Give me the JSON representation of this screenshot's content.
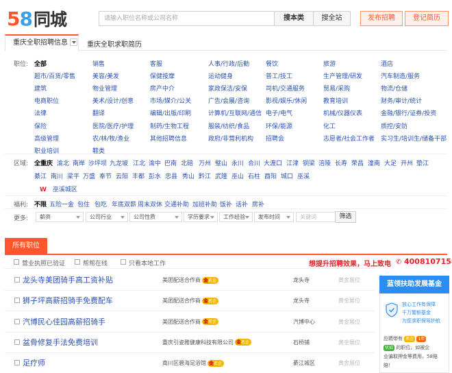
{
  "header": {
    "logo_num_a": "5",
    "logo_num_b": "8",
    "logo_cn": "同城",
    "search_placeholder": "请输入职位名称或公司名称",
    "search_button": "搜本类",
    "search_all_button": "搜全站",
    "post_button": "发布招聘",
    "resume_button": "登记简历"
  },
  "tabs": {
    "tab1": "重庆全职招聘信息",
    "tab2": "重庆全职求职简历"
  },
  "jobs": {
    "label": "职位:",
    "items": [
      "全部",
      "销售",
      "客服",
      "人事/行政/后勤",
      "餐饮",
      "旅游",
      "酒店",
      "超市/百货/零售",
      "美容/美发",
      "保健按摩",
      "运动健身",
      "普工/技工",
      "生产管理/研发",
      "汽车制造/服务",
      "建筑",
      "物业管理",
      "房产中介",
      "家政保洁/安保",
      "司机/交通服务",
      "贸易/采购",
      "物流/仓储",
      "电商职位",
      "美术/设计/创意",
      "市场/媒介/公关",
      "广告/会展/咨询",
      "影视/娱乐/休闲",
      "教育培训",
      "财务/审计/统计",
      "法律",
      "翻译",
      "编辑/出版/印刷",
      "计算机/互联网/通信",
      "电子/电气",
      "机械/仪器仪表",
      "金融/银行/证券/投资",
      "保险",
      "医院/医疗/护理",
      "制药/生物工程",
      "服装/纺织/食品",
      "环保/能源",
      "化工",
      "质控/安防",
      "高级管理",
      "农/林/牧/渔业",
      "其他招聘信息",
      "政府/非营利机构",
      "招聘会",
      "志愿者/社会工作者",
      "实习生/培训生/储备干部",
      "职业培训",
      "鞋类"
    ]
  },
  "areas": {
    "label": "区域:",
    "row1": [
      "全重庆",
      "渝北",
      "南岸",
      "沙坪坝",
      "九龙坡",
      "江北",
      "渝中",
      "巴南",
      "北碚",
      "万州",
      "璧山",
      "永川",
      "合川",
      "大渡口",
      "江津",
      "铜梁",
      "涪陵",
      "长寿",
      "荣昌",
      "潼南",
      "大足",
      "开州",
      "垫江"
    ],
    "row2": [
      "綦江",
      "南川",
      "梁平",
      "万盛",
      "奉节",
      "云阳",
      "丰都",
      "彭水",
      "忠县",
      "秀山",
      "黔江",
      "武隆",
      "巫山",
      "石柱",
      "酉阳",
      "城口",
      "巫溪"
    ],
    "w_badge": "W",
    "wuxi_town": "巫溪城区"
  },
  "welfare": {
    "label": "福利:",
    "items": [
      "不限",
      "五险一金",
      "包住",
      "包吃",
      "年底双薪",
      "周末双休",
      "交通补助",
      "加班补助",
      "饭补",
      "话补",
      "房补"
    ]
  },
  "more": {
    "label": "更多:",
    "filters": [
      "薪资",
      "公司行业",
      "公司性质",
      "学历要求",
      "工作经验",
      "发布时间"
    ],
    "keyword_placeholder": "关键词",
    "filter_button": "筛选"
  },
  "listing": {
    "all_tab": "所有职位",
    "opt1": "营业执照已验证",
    "opt2": "帮帮在线",
    "opt3": "只看本地工作",
    "promo": "想提升招聘效果，马上致电",
    "phone": "4008107158",
    "gold_badge_g": "金",
    "gold_badge_text": "名企",
    "rows": [
      {
        "title": "龙头寺美团骑手高工资补贴",
        "company": "美团配送合作商",
        "loc": "龙头寺",
        "rank": "黄金展位"
      },
      {
        "title": "狮子坪高薪招骑手免费配车",
        "company": "美团配送合作商",
        "loc": "龙头寺",
        "rank": "黄金展位"
      },
      {
        "title": "汽博民心佳园高薪招骑手",
        "company": "美团配送合作商",
        "loc": "汽博中心",
        "rank": "黄金展位"
      },
      {
        "title": "盆骨修复手法免费培训",
        "company": "重庆引姿雅健康科技有限公司",
        "loc": "石桥铺",
        "rank": "黄金展位"
      },
      {
        "title": "足疗师",
        "company": "南川区碧海足浴馆",
        "loc": "綦江城区",
        "rank": "黄金展位"
      }
    ]
  },
  "side": {
    "title": "蓝领扶助发展基金",
    "line1": "放心工作有保障",
    "line2": "千万警额基金",
    "line3": "为您求职保驾护航",
    "desc1": "应聘带有",
    "desc2": "的职位，如被企",
    "desc3": "业骗取押金等费用，58赔",
    "desc4": "赔！",
    "badge_a": "名企",
    "badge_b": "1年",
    "badge_c": "优招",
    "badge_a_color": "#f7b500",
    "badge_b_color": "#ff6a00",
    "badge_c_color": "#3cb034"
  }
}
